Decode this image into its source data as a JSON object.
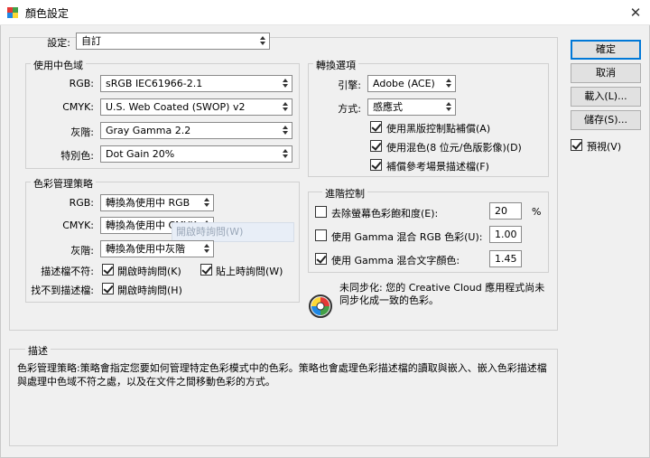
{
  "window": {
    "title": "顏色設定",
    "close_glyph": "✕"
  },
  "settings": {
    "label": "設定:",
    "value": "自訂"
  },
  "working_spaces": {
    "title": "使用中色域",
    "rows": [
      {
        "label": "RGB:",
        "value": "sRGB IEC61966-2.1"
      },
      {
        "label": "CMYK:",
        "value": "U.S. Web Coated (SWOP) v2"
      },
      {
        "label": "灰階:",
        "value": "Gray Gamma 2.2"
      },
      {
        "label": "特別色:",
        "value": "Dot Gain 20%"
      }
    ]
  },
  "policies": {
    "title": "色彩管理策略",
    "rows": [
      {
        "label": "RGB:",
        "value": "轉換為使用中 RGB"
      },
      {
        "label": "CMYK:",
        "value": "轉換為使用中 CMYK"
      },
      {
        "label": "灰階:",
        "value": "轉換為使用中灰階"
      }
    ],
    "mismatch_label": "描述檔不符:",
    "mismatch_open": "開啟時詢問(K)",
    "mismatch_paste": "貼上時詢問(W)",
    "missing_label": "找不到描述檔:",
    "missing_open": "開啟時詢問(H)",
    "tooltip": "開啟時詢問(W)"
  },
  "conversion": {
    "title": "轉換選項",
    "engine_label": "引擎:",
    "engine_value": "Adobe (ACE)",
    "intent_label": "方式:",
    "intent_value": "感應式",
    "options": [
      {
        "label": "使用黑版控制點補償(A)",
        "checked": true
      },
      {
        "label": "使用混色(8 位元/色版影像)(D)",
        "checked": true
      },
      {
        "label": "補償參考場景描述檔(F)",
        "checked": true
      }
    ]
  },
  "advanced": {
    "title": "進階控制",
    "desaturate_label": "去除螢幕色彩飽和度(E):",
    "desaturate_value": "20",
    "desaturate_unit": "%",
    "blend_rgb_label": "使用 Gamma 混合 RGB 色彩(U):",
    "blend_rgb_value": "1.00",
    "blend_text_label": "使用 Gamma 混合文字顏色:",
    "blend_text_value": "1.45"
  },
  "sync": {
    "icon": "sync-wheel-icon",
    "message": "未同步化: 您的 Creative Cloud 應用程式尚未同步化成一致的色彩。"
  },
  "description": {
    "title": "描述",
    "text": "色彩管理策略:策略會指定您要如何管理特定色彩模式中的色彩。策略也會處理色彩描述檔的讀取與嵌入、嵌入色彩描述檔與處理中色域不符之處，以及在文件之間移動色彩的方式。"
  },
  "buttons": {
    "ok": "確定",
    "cancel": "取消",
    "load": "載入(L)...",
    "save": "儲存(S)...",
    "preview": "預視(V)"
  },
  "colors": {
    "accent": "#0078d7"
  }
}
